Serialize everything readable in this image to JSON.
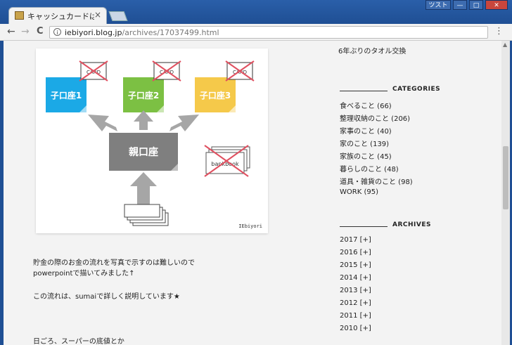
{
  "window": {
    "tab_title": "キャッシュカードは作っ",
    "tab_close": "×",
    "user_button": "ツスト",
    "minimize": "—",
    "maximize": "□",
    "close": "✕"
  },
  "toolbar": {
    "back": "←",
    "forward": "→",
    "reload": "C",
    "info": "i",
    "url_host": "iebiyori.blog.jp",
    "url_path": "/archives/17037499.html",
    "menu": "⋮"
  },
  "figure": {
    "accounts": [
      {
        "label": "子口座1",
        "color": "#1ba9e6"
      },
      {
        "label": "子口座2",
        "color": "#7cc043"
      },
      {
        "label": "子口座3",
        "color": "#f5c94a"
      }
    ],
    "card_label": "CARD",
    "parent_label": "親口座",
    "parent_color": "#7f7f7f",
    "bankbook_label": "bankbook",
    "cross_color": "#e05060",
    "arrow_color": "#a6a6a6",
    "watermark": "IEbiyori"
  },
  "article": {
    "line1": "貯金の際のお金の流れを写真で示すのは難しいので",
    "line2": "powerpointで描いてみました↑",
    "line3": "この流れは、sumaiで詳しく説明しています★",
    "line4": "日ごろ、スーパーの底値とか"
  },
  "sidebar": {
    "recent_post": "6年ぶりのタオル交換",
    "categories_title": "CATEGORIES",
    "categories": [
      "食べること (66)",
      "整理収納のこと (206)",
      "家事のこと (40)",
      "家のこと (139)",
      "家族のこと (45)",
      "暮らしのこと (48)",
      "道具・雑貨のこと (98)",
      "WORK (95)"
    ],
    "archives_title": "ARCHIVES",
    "archives": [
      "2017 [+]",
      "2016 [+]",
      "2015 [+]",
      "2014 [+]",
      "2013 [+]",
      "2012 [+]",
      "2011 [+]",
      "2010 [+]"
    ]
  }
}
